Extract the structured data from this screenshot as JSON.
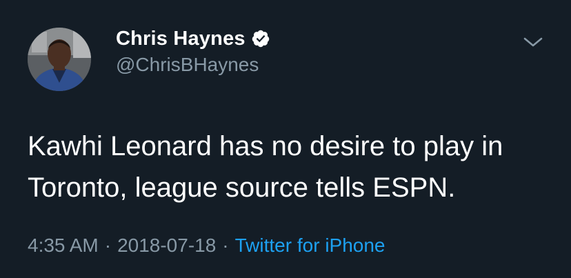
{
  "author": {
    "display_name": "Chris Haynes",
    "handle": "@ChrisBHaynes",
    "verified": true
  },
  "tweet": {
    "text": "Kawhi Leonard has no desire to play in\nToronto, league source tells ESPN."
  },
  "meta": {
    "time": "4:35 AM",
    "separator": "·",
    "date": "2018-07-18",
    "source": "Twitter for iPhone"
  },
  "icons": {
    "verified": "verified-badge-icon",
    "menu": "chevron-down-icon"
  },
  "colors": {
    "background": "#141d26",
    "primary_text": "#ffffff",
    "secondary_text": "#8899a6",
    "link": "#1da1f2"
  }
}
